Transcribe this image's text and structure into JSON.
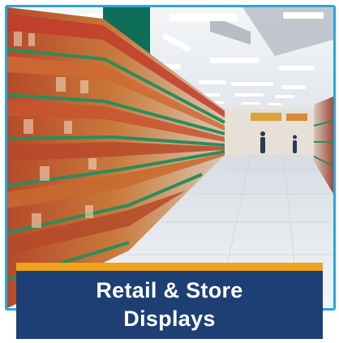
{
  "caption": {
    "line1": "Retail & Store",
    "line2": "Displays"
  },
  "image": {
    "subject": "supermarket-aisle-photo"
  },
  "colors": {
    "frame_border": "#2aa6df",
    "caption_background": "#1d3f74",
    "caption_accent_band": "#f0a21a",
    "caption_text": "#ffffff"
  }
}
